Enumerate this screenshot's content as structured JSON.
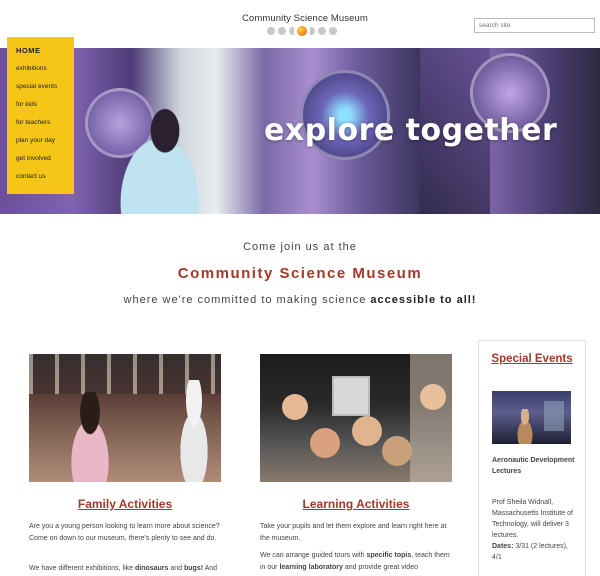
{
  "header": {
    "logo_text": "Community Science Museum",
    "search_placeholder": "search site"
  },
  "nav": {
    "home": "HOME",
    "items": [
      "exhibitions",
      "special events",
      "for kids",
      "for teachers",
      "plan your day",
      "get involved",
      "contact us"
    ]
  },
  "hero": {
    "title": "explore together"
  },
  "intro": {
    "line1": "Come join us at the",
    "line2": "Community Science Museum",
    "line3_prefix": "where we're committed to making science ",
    "line3_bold": "accessible to all!"
  },
  "family": {
    "title": "Family Activities",
    "p1": "Are you a young person looking to learn more about science? Come on down to our museum, there's plenty to see and do.",
    "p2_prefix": "We have different exhibitions, like ",
    "p2_bold1": "dinosaurs",
    "p2_mid": " and ",
    "p2_bold2": "bugs!",
    "p2_suffix": " And"
  },
  "learning": {
    "title": "Learning Activities",
    "p1": "Take your pupils and let them explore and learn right here at the museum.",
    "p2_prefix": "We can arrange guided tours with ",
    "p2_bold1": "specific topis",
    "p2_mid": ", teach them in our ",
    "p2_bold2": "learning laboratory",
    "p2_suffix": " and provide great video"
  },
  "events": {
    "title": "Special Events",
    "event_name": "Aeronautic Development Lectures",
    "event_desc": "Prof Sheila Widnall, Massachusetts Institute of Technology, will deliver 3 lectures.",
    "dates_label": "Dates:",
    "dates_value": " 3/31 (2 lectures), 4/1"
  },
  "colors": {
    "accent": "#a3392a",
    "nav_bg": "#f5c518"
  }
}
